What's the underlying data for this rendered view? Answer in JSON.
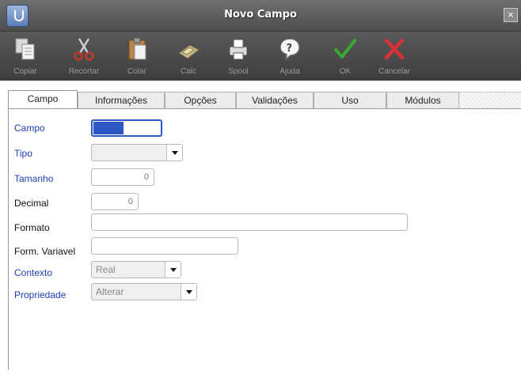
{
  "window": {
    "title": "Novo Campo",
    "close_glyph": "×"
  },
  "toolbar": {
    "items": [
      {
        "label": "Copiar",
        "icon": "copy-icon"
      },
      {
        "label": "Recortar",
        "icon": "scissors-icon"
      },
      {
        "label": "Colar",
        "icon": "paste-icon"
      },
      {
        "label": "Calc",
        "icon": "calculator-icon"
      },
      {
        "label": "Spool",
        "icon": "printer-icon"
      },
      {
        "label": "Ajuda",
        "icon": "help-icon"
      },
      {
        "label": "OK",
        "icon": "check-icon"
      },
      {
        "label": "Cancelar",
        "icon": "cancel-icon"
      }
    ]
  },
  "tabs": [
    {
      "label": "Campo",
      "active": true
    },
    {
      "label": "Informações"
    },
    {
      "label": "Opções"
    },
    {
      "label": "Validações"
    },
    {
      "label": "Uso"
    },
    {
      "label": "Módulos"
    }
  ],
  "form": {
    "campo": {
      "label": "Campo",
      "value": ""
    },
    "tipo": {
      "label": "Tipo",
      "value": ""
    },
    "tamanho": {
      "label": "Tamanho",
      "value": "0"
    },
    "decimal": {
      "label": "Decimal",
      "value": "0"
    },
    "formato": {
      "label": "Formato",
      "value": ""
    },
    "form_variavel": {
      "label": "Form. Variavel",
      "value": ""
    },
    "contexto": {
      "label": "Contexto",
      "value": "Real"
    },
    "propriedade": {
      "label": "Propriedade",
      "value": "Alterar"
    }
  },
  "colors": {
    "required_label": "#1f3fb0",
    "focus_border": "#2d57c2",
    "ok_green": "#3aa832",
    "cancel_red": "#d9303a"
  }
}
